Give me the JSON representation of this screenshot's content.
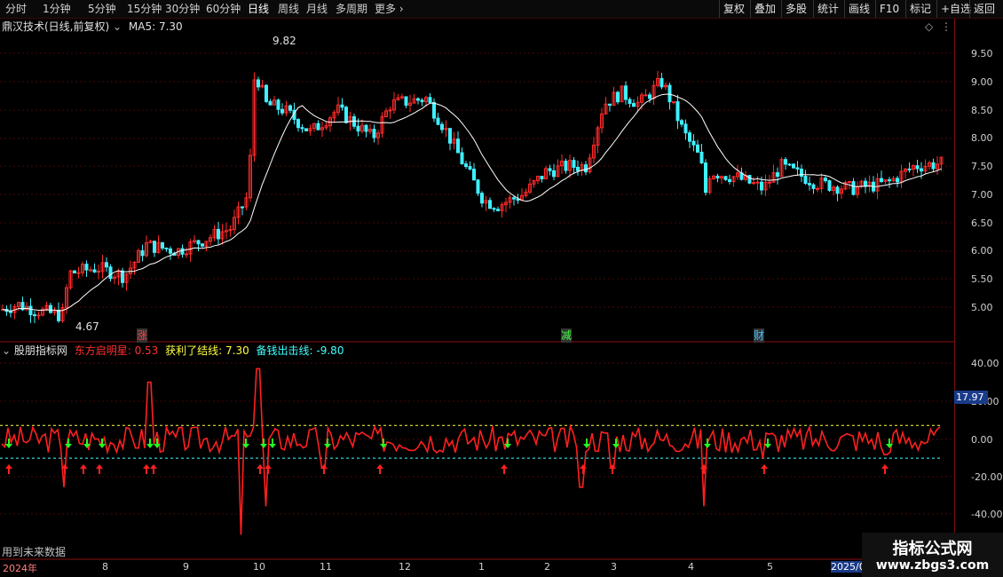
{
  "toolbar": {
    "periods": [
      "分时",
      "1分钟",
      "5分钟",
      "15分钟",
      "30分钟",
      "60分钟",
      "日线",
      "周线",
      "月线",
      "多周期",
      "更多"
    ],
    "active_period": "日线",
    "right_buttons": [
      "复权",
      "叠加",
      "多股",
      "统计",
      "画线",
      "F10",
      "标记",
      "+自选",
      "返回"
    ]
  },
  "main_panel": {
    "title": "鼎汉技术(日线,前复权)",
    "ma_label": "MA5: 7.30",
    "high_marker": "9.82",
    "low_marker": "4.67",
    "events": [
      "涨",
      "减",
      "财"
    ],
    "diamond_icon": "diamond-icon",
    "colors": {
      "up": "#ff2a2a",
      "down": "#3ff0ff",
      "ma": "#ffffff",
      "grid": "#5a0a0a"
    }
  },
  "indicator_panel": {
    "title": "股朋指标网",
    "lines": [
      {
        "label": "东方启明星: 0.53",
        "color": "#ff3030"
      },
      {
        "label": "获利了结线: 7.30",
        "color": "#ffff40"
      },
      {
        "label": "备钱出击线: -9.80",
        "color": "#40ffff"
      }
    ],
    "current_value_tag": "17.97",
    "footer_note": "用到未来数据"
  },
  "x_axis": [
    "2024年",
    "8",
    "9",
    "10",
    "11",
    "12",
    "1",
    "2",
    "3",
    "4",
    "5",
    "2025/0"
  ],
  "main_y_axis": [
    "9.50",
    "9.00",
    "8.50",
    "8.00",
    "7.50",
    "7.00",
    "6.50",
    "6.00",
    "5.50",
    "5.00"
  ],
  "indicator_y_axis": [
    "40.00",
    "20.00",
    "0.00",
    "-20.00",
    "-40.00"
  ],
  "watermark": {
    "title": "指标公式网",
    "url": "www.zbgs3.com"
  },
  "chart_data": {
    "type": "candlestick",
    "series": [
      {
        "name": "MA5",
        "values": []
      },
      {
        "name": "东方启明星",
        "values": []
      },
      {
        "name": "获利了结线",
        "values": [
          7.3
        ]
      },
      {
        "name": "备钱出击线",
        "values": [
          -9.8
        ]
      }
    ],
    "ylim": [
      4.67,
      9.82
    ],
    "indicator_ylim": [
      -50,
      45
    ]
  }
}
